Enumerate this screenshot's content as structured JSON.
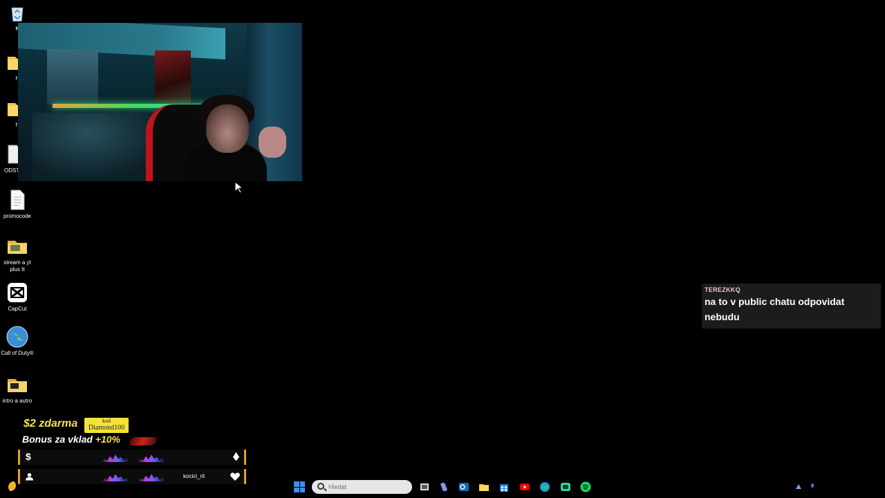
{
  "desktop_icons": [
    {
      "label": "K",
      "icon": "recycle-bin-icon"
    },
    {
      "label": "h",
      "icon": "folder-icon"
    },
    {
      "label": "h",
      "icon": "folder-icon"
    },
    {
      "label": "ODSTR",
      "icon": "document-icon"
    },
    {
      "label": "promocode",
      "icon": "text-file-icon"
    },
    {
      "label": "stream a yt plus tt",
      "icon": "folder-icon"
    },
    {
      "label": "CapCut",
      "icon": "capcut-icon"
    },
    {
      "label": "Call of Duty®",
      "icon": "globe-icon"
    },
    {
      "label": "intro a autro",
      "icon": "folder-icon"
    }
  ],
  "chat": {
    "username": "TEREZKKQ",
    "message": "na to v public chatu odpovidat nebudu"
  },
  "promo": {
    "line1": "$2 zdarma",
    "code_label": "kod",
    "code_value": "Diamond100",
    "line2": "Bonus za vklad",
    "line2_pct": "+10%"
  },
  "stat_bars": [
    {
      "left_icon": "$",
      "name": "",
      "right_icon": "diamond-icon"
    },
    {
      "left_icon": "person-icon",
      "name": "kocici_rit",
      "right_icon": "heart-icon"
    }
  ],
  "taskbar": {
    "search_placeholder": "Hledat",
    "apps": [
      "task-view-icon",
      "copilot-icon",
      "outlook-icon",
      "file-explorer-icon",
      "store-icon",
      "youtube-icon",
      "edge-icon",
      "discord-icon",
      "spotify-icon"
    ]
  },
  "colors": {
    "accent_yellow": "#f5e24a",
    "bar_border": "#e8a020",
    "windows_blue": "#3b8ff5"
  }
}
